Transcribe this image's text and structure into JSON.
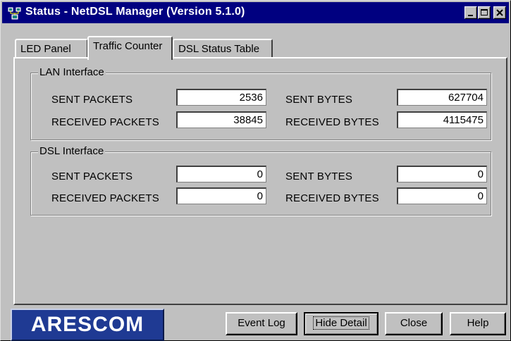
{
  "window": {
    "title": "Status - NetDSL Manager (Version 5.1.0)",
    "title_icon": "network-icon"
  },
  "tabs": [
    {
      "label": "LED Panel",
      "active": false
    },
    {
      "label": "Traffic Counter",
      "active": true
    },
    {
      "label": "DSL Status Table",
      "active": false
    }
  ],
  "lan": {
    "group_label": "LAN Interface",
    "sent_packets_label": "SENT PACKETS",
    "sent_packets": "2536",
    "received_packets_label": "RECEIVED PACKETS",
    "received_packets": "38845",
    "sent_bytes_label": "SENT BYTES",
    "sent_bytes": "627704",
    "received_bytes_label": "RECEIVED BYTES",
    "received_bytes": "4115475"
  },
  "dsl": {
    "group_label": "DSL Interface",
    "sent_packets_label": "SENT PACKETS",
    "sent_packets": "0",
    "received_packets_label": "RECEIVED PACKETS",
    "received_packets": "0",
    "sent_bytes_label": "SENT BYTES",
    "sent_bytes": "0",
    "received_bytes_label": "RECEIVED BYTES",
    "received_bytes": "0"
  },
  "footer": {
    "logo_text": "ARESCOM",
    "event_log_label": "Event Log",
    "hide_detail_label": "Hide Detail",
    "close_label": "Close",
    "help_label": "Help"
  },
  "colors": {
    "titlebar": "#000080",
    "face": "#c0c0c0",
    "logo_bg": "#1f3a93"
  }
}
